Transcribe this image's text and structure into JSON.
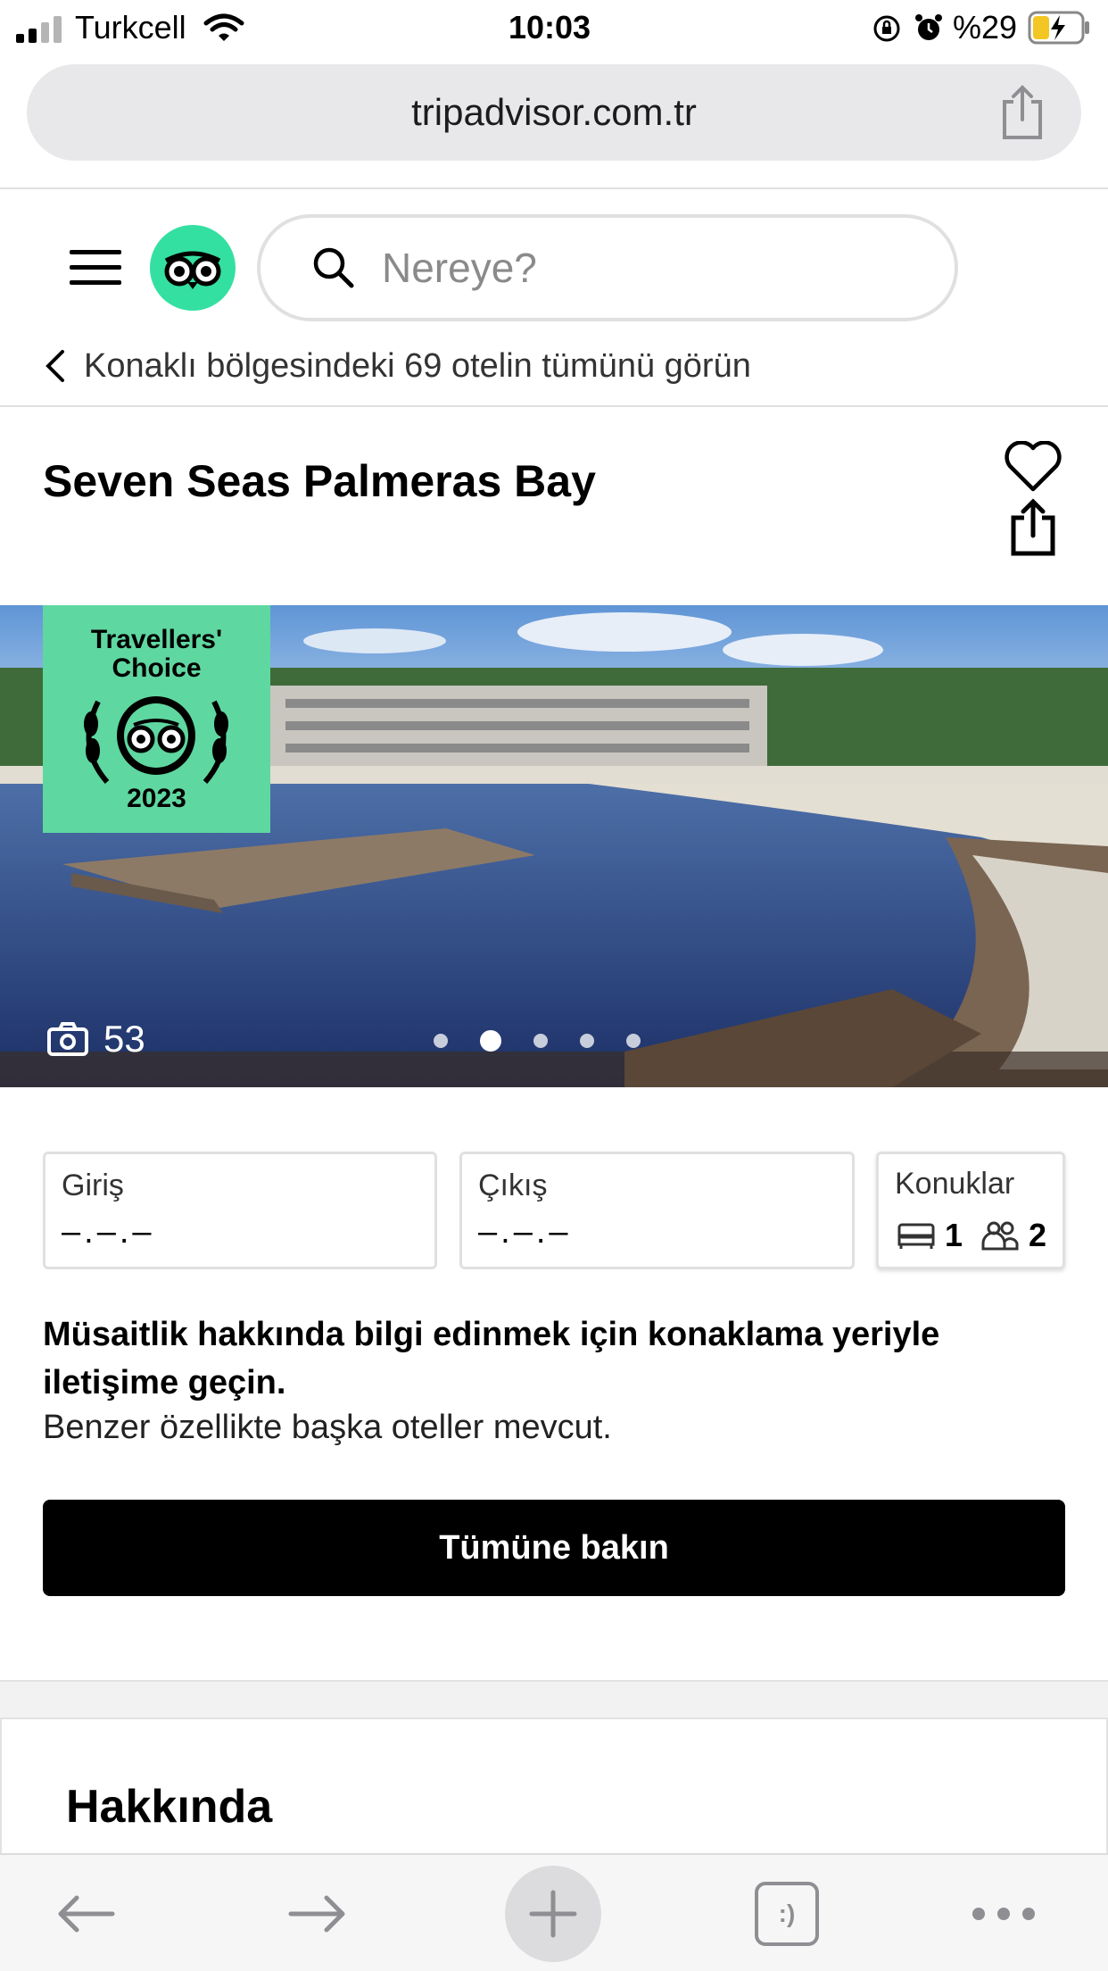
{
  "status_bar": {
    "carrier": "Turkcell",
    "time": "10:03",
    "battery_percent": "%29"
  },
  "browser": {
    "url": "tripadvisor.com.tr",
    "tabs_count_label": ":)"
  },
  "header": {
    "search_placeholder": "Nereye?",
    "back_link": "Konaklı bölgesindeki 69 otelin tümünü görün"
  },
  "hotel": {
    "name": "Seven Seas Palmeras Bay",
    "badge": {
      "line1": "Travellers'",
      "line2": "Choice",
      "year": "2023"
    },
    "photo_count": "53",
    "carousel": {
      "total": 5,
      "active_index": 1
    }
  },
  "booking": {
    "checkin_label": "Giriş",
    "checkin_value": "–.–.–",
    "checkout_label": "Çıkış",
    "checkout_value": "–.–.–",
    "guests_label": "Konuklar",
    "rooms": "1",
    "guests": "2"
  },
  "info": {
    "bold_text": "Müsaitlik hakkında bilgi edinmek için konaklama yeriyle iletişime geçin.",
    "normal_text": "Benzer özellikte başka oteller mevcut.",
    "cta_label": "Tümüne bakın"
  },
  "about": {
    "title": "Hakkında"
  },
  "colors": {
    "brand_green": "#34e0a1",
    "badge_green": "#5fd7a0",
    "cta_black": "#000000"
  },
  "icons": [
    "signal-icon",
    "wifi-icon",
    "orientation-lock-icon",
    "alarm-icon",
    "battery-icon",
    "share-icon",
    "menu-icon",
    "tripadvisor-logo-icon",
    "search-icon",
    "chevron-left-icon",
    "heart-icon",
    "camera-icon",
    "bed-icon",
    "people-icon",
    "back-arrow-icon",
    "forward-arrow-icon",
    "plus-icon",
    "tabs-icon",
    "more-icon"
  ]
}
